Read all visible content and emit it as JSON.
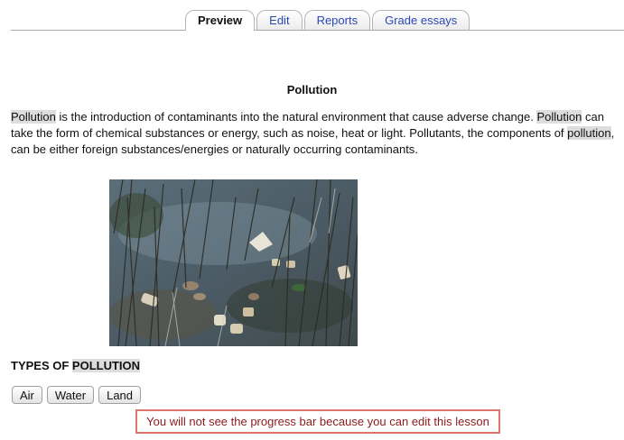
{
  "tabs": [
    {
      "label": "Preview",
      "active": true
    },
    {
      "label": "Edit",
      "active": false
    },
    {
      "label": "Reports",
      "active": false
    },
    {
      "label": "Grade essays",
      "active": false
    }
  ],
  "page": {
    "title": "Pollution",
    "paragraph": {
      "w1": "Pollution",
      "t1": " is the introduction of contaminants into the natural environment that cause adverse change. ",
      "w2": "Pollution",
      "t2": " can take the form of chemical substances or energy, such as noise, heat or light. Pollutants, the components of ",
      "w3": "pollution",
      "t3": ", can be either foreign substances/energies or naturally occurring contaminants."
    },
    "image": {
      "icon": "polluted-water-photo"
    },
    "subheading": {
      "prefix": "TYPES OF ",
      "highlight": "POLLUTION"
    },
    "buttons": [
      "Air",
      "Water",
      "Land"
    ],
    "notice": "You will not see the progress bar because you can edit this lesson"
  },
  "colors": {
    "link": "#2a47b8",
    "highlight": "#dddddd",
    "notice_border": "#e0736b",
    "notice_text": "#8b1a1a"
  }
}
